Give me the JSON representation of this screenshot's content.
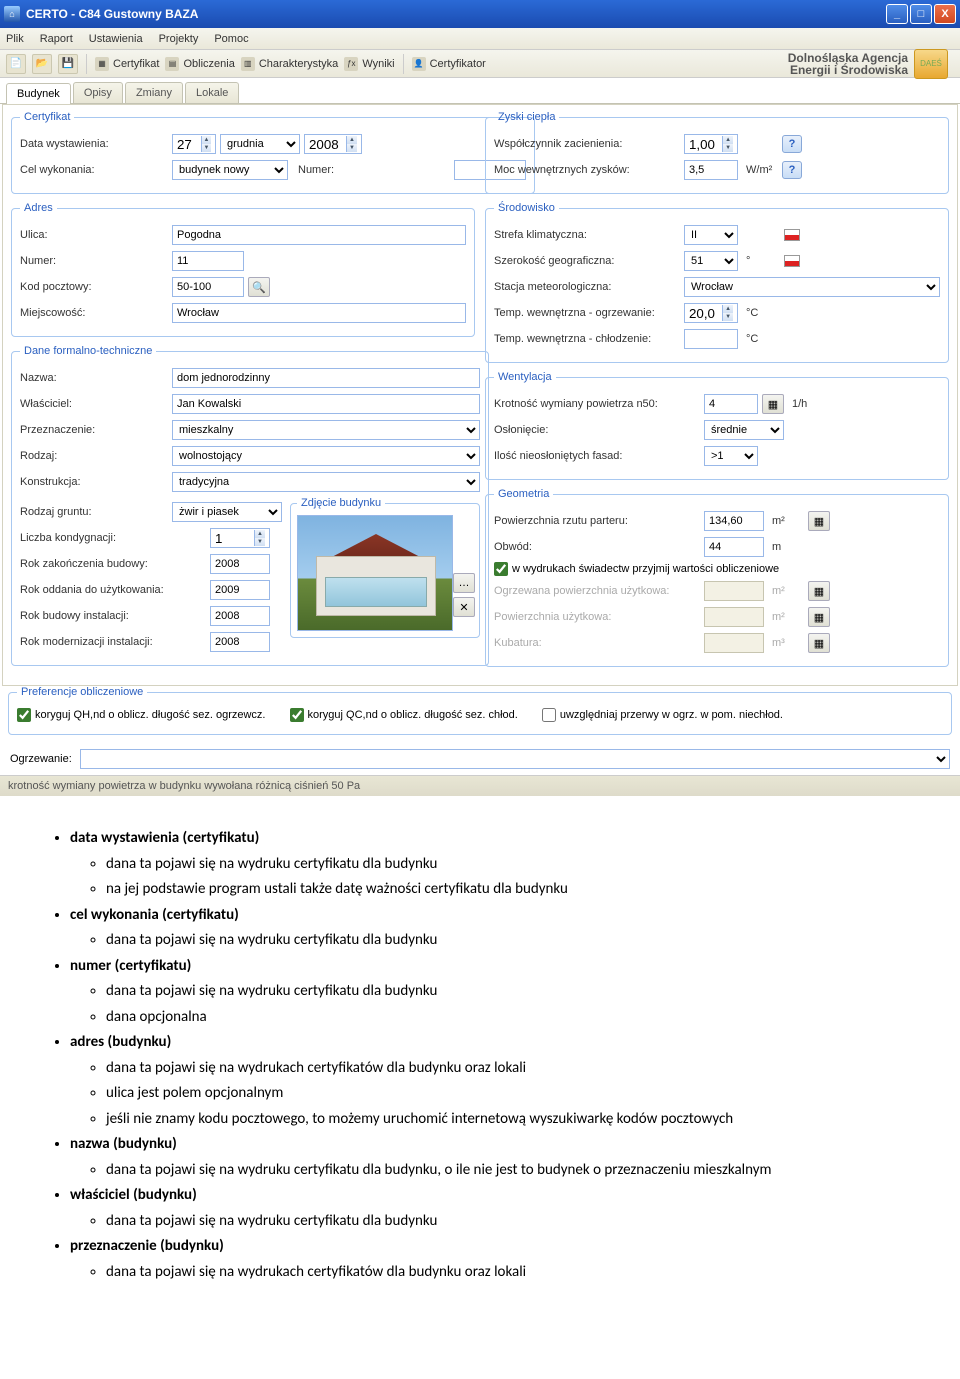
{
  "window": {
    "title": "CERTO - C84 Gustowny BAZA",
    "buttons": {
      "min": "_",
      "max": "□",
      "close": "X"
    }
  },
  "menubar": [
    "Plik",
    "Raport",
    "Ustawienia",
    "Projekty",
    "Pomoc"
  ],
  "toolbar": {
    "items": [
      {
        "label": "Certyfikat"
      },
      {
        "label": "Obliczenia"
      },
      {
        "label": "Charakterystyka"
      },
      {
        "label": "Wyniki"
      },
      {
        "label": "Certyfikator"
      }
    ]
  },
  "brand": {
    "line1": "Dolnośląska Agencja",
    "line2": "Energii i Środowiska",
    "badge": "DAEŚ"
  },
  "tabs": [
    {
      "label": "Budynek",
      "active": true
    },
    {
      "label": "Opisy"
    },
    {
      "label": "Zmiany"
    },
    {
      "label": "Lokale"
    }
  ],
  "left": {
    "certyfikat": {
      "legend": "Certyfikat",
      "data_wyst_label": "Data wystawienia:",
      "date_day": "27",
      "date_month": "grudnia",
      "date_year": "2008",
      "cel_label": "Cel wykonania:",
      "cel_value": "budynek nowy",
      "numer_label": "Numer:",
      "numer_value": ""
    },
    "adres": {
      "legend": "Adres",
      "ulica_label": "Ulica:",
      "ulica": "Pogodna",
      "numer_label": "Numer:",
      "numer": "11",
      "kod_label": "Kod pocztowy:",
      "kod": "50-100",
      "miejsc_label": "Miejscowość:",
      "miejsc": "Wrocław"
    },
    "dane": {
      "legend": "Dane formalno-techniczne",
      "nazwa_label": "Nazwa:",
      "nazwa": "dom jednorodzinny",
      "wlasciciel_label": "Właściciel:",
      "wlasciciel": "Jan Kowalski",
      "przezn_label": "Przeznaczenie:",
      "przezn": "mieszkalny",
      "rodzaj_label": "Rodzaj:",
      "rodzaj": "wolnostojący",
      "konstr_label": "Konstrukcja:",
      "konstr": "tradycyjna",
      "grunt_label": "Rodzaj gruntu:",
      "grunt": "żwir i piasek",
      "kondyg_label": "Liczba kondygnacji:",
      "kondyg": "1",
      "rok_zak_label": "Rok zakończenia budowy:",
      "rok_zak": "2008",
      "rok_uzy_label": "Rok oddania do użytkowania:",
      "rok_uzy": "2009",
      "rok_inst_label": "Rok budowy instalacji:",
      "rok_inst": "2008",
      "rok_mod_label": "Rok modernizacji instalacji:",
      "rok_mod": "2008",
      "zdjecie_legend": "Zdjęcie budynku"
    }
  },
  "right": {
    "zyski": {
      "legend": "Zyski ciepła",
      "wsp_label": "Współczynnik zacienienia:",
      "wsp": "1,00",
      "moc_label": "Moc wewnętrznych zysków:",
      "moc": "3,5",
      "moc_unit": "W/m²"
    },
    "srod": {
      "legend": "Środowisko",
      "strefa_label": "Strefa klimatyczna:",
      "strefa": "II",
      "szer_label": "Szerokość geograficzna:",
      "szer": "51",
      "szer_unit": "°",
      "stacja_label": "Stacja meteorologiczna:",
      "stacja": "Wrocław",
      "tw_ogrz_label": "Temp. wewnętrzna - ogrzewanie:",
      "tw_ogrz": "20,0",
      "tw_ogrz_unit": "°C",
      "tw_chlod_label": "Temp. wewnętrzna - chłodzenie:",
      "tw_chlod": "",
      "tw_chlod_unit": "°C"
    },
    "went": {
      "legend": "Wentylacja",
      "krot_label": "Krotność wymiany powietrza n50:",
      "krot": "4",
      "krot_unit": "1/h",
      "oslon_label": "Osłonięcie:",
      "oslon": "średnie",
      "fasad_label": "Ilość nieosłoniętych fasad:",
      "fasad": ">1"
    },
    "geom": {
      "legend": "Geometria",
      "pow_rzut_label": "Powierzchnia rzutu parteru:",
      "pow_rzut": "134,60",
      "pow_rzut_unit": "m²",
      "obwod_label": "Obwód:",
      "obwod": "44",
      "obwod_unit": "m",
      "chk_label": "w wydrukach świadectw przyjmij wartości obliczeniowe",
      "ogrz_pow_label": "Ogrzewana powierzchnia użytkowa:",
      "ogrz_pow_unit": "m²",
      "pow_uzy_label": "Powierzchnia użytkowa:",
      "pow_uzy_unit": "m²",
      "kub_label": "Kubatura:",
      "kub_unit": "m³"
    }
  },
  "prefs": {
    "legend": "Preferencje obliczeniowe",
    "chk1": "koryguj QH,nd o oblicz. długość sez. ogrzewcz.",
    "chk2": "koryguj QC,nd o oblicz. długość sez. chłod.",
    "chk3": "uwzględniaj przerwy w ogrz. w pom. niechłod."
  },
  "bottom": {
    "ogrz_label": "Ogrzewanie:",
    "ogrz_value": ""
  },
  "status": "krotność wymiany powietrza w budynku wywołana różnicą ciśnień 50 Pa",
  "doc": {
    "b1": "data wystawienia (certyfikatu)",
    "b1_1": "dana ta pojawi się na wydruku certyfikatu dla budynku",
    "b1_2": "na jej podstawie program ustali także datę ważności certyfikatu dla budynku",
    "b2": "cel wykonania (certyfikatu)",
    "b2_1": "dana ta pojawi się na wydruku certyfikatu dla budynku",
    "b3": "numer (certyfikatu)",
    "b3_1": "dana ta pojawi się na wydruku certyfikatu dla budynku",
    "b3_2": "dana opcjonalna",
    "b4": "adres (budynku)",
    "b4_1": "dana ta pojawi się na wydrukach certyfikatów dla budynku oraz lokali",
    "b4_2": "ulica jest polem opcjonalnym",
    "b4_3": "jeśli nie znamy kodu pocztowego, to możemy uruchomić internetową wyszukiwarkę kodów pocztowych",
    "b5": "nazwa (budynku)",
    "b5_1": "dana ta pojawi się na wydruku certyfikatu dla budynku, o ile nie jest to budynek o przeznaczeniu mieszkalnym",
    "b6": "właściciel (budynku)",
    "b6_1": "dana ta pojawi się na wydruku certyfikatu dla budynku",
    "b7": "przeznaczenie (budynku)",
    "b7_1": "dana ta pojawi się na wydrukach certyfikatów dla budynku oraz lokali"
  }
}
